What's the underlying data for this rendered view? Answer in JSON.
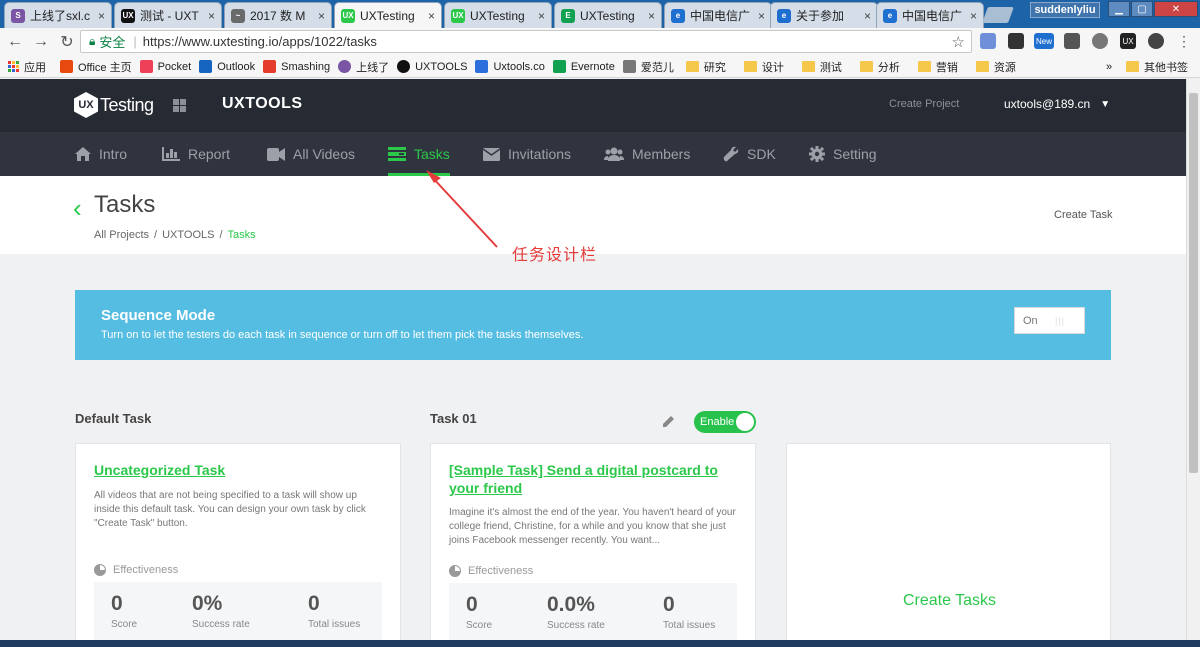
{
  "browser": {
    "tabs": [
      {
        "label": "上线了sxl.c",
        "icon_color": "#7a55a3",
        "icon_text": "S",
        "close": "×"
      },
      {
        "label": "测试 - UXT",
        "icon_color": "#111111",
        "icon_text": "UX",
        "close": "×"
      },
      {
        "label": "2017 数 M",
        "icon_color": "#6a6a6a",
        "icon_text": "~",
        "close": "×"
      },
      {
        "label": "UXTesting",
        "icon_color": "#2bc84a",
        "icon_text": "UX",
        "close": "×",
        "active": true
      },
      {
        "label": "UXTesting",
        "icon_color": "#2bc84a",
        "icon_text": "UX",
        "close": "×"
      },
      {
        "label": "UXTesting",
        "icon_color": "#12a150",
        "icon_text": "E",
        "close": "×"
      },
      {
        "label": "中国电信广",
        "icon_color": "#1f6fd1",
        "icon_text": "e",
        "close": "×"
      },
      {
        "label": "关于参加",
        "icon_color": "#1f6fd1",
        "icon_text": "e",
        "close": "×"
      },
      {
        "label": "中国电信广",
        "icon_color": "#1f6fd1",
        "icon_text": "e",
        "close": "×"
      }
    ],
    "profile": "suddenlyliu",
    "url_secure_label": "安全",
    "url_separator": "|",
    "url": "https://www.uxtesting.io/apps/1022/tasks",
    "bookmarks": [
      {
        "label": "应用",
        "type": "apps"
      },
      {
        "label": "Office 主页",
        "type": "icon",
        "color": "#e8490f"
      },
      {
        "label": "Pocket",
        "type": "icon",
        "color": "#ee4056"
      },
      {
        "label": "Outlook",
        "type": "icon",
        "color": "#1565c0"
      },
      {
        "label": "Smashing",
        "type": "icon",
        "color": "#e53b2c"
      },
      {
        "label": "上线了",
        "type": "icon",
        "color": "#7a55a3"
      },
      {
        "label": "UXTOOLS",
        "type": "icon",
        "color": "#111111"
      },
      {
        "label": "Uxtools.co",
        "type": "icon",
        "color": "#2a6fdb"
      },
      {
        "label": "Evernote",
        "type": "icon",
        "color": "#12a150"
      },
      {
        "label": "爱范儿",
        "type": "icon",
        "color": "#777777"
      },
      {
        "label": "研究",
        "type": "folder"
      },
      {
        "label": "设计",
        "type": "folder"
      },
      {
        "label": "测试",
        "type": "folder"
      },
      {
        "label": "分析",
        "type": "folder"
      },
      {
        "label": "营销",
        "type": "folder"
      },
      {
        "label": "资源",
        "type": "folder"
      }
    ],
    "bookmarks_overflow": "»",
    "other_bookmarks": "其他书签"
  },
  "app": {
    "logo_badge": "UX",
    "logo_text": "Testing",
    "project_name": "UXTOOLS",
    "create_project": "Create Project",
    "user_email": "uxtools@189.cn",
    "nav": [
      {
        "label": "Intro",
        "icon": "home-icon"
      },
      {
        "label": "Report",
        "icon": "bar-chart-icon"
      },
      {
        "label": "All Videos",
        "icon": "video-camera-icon"
      },
      {
        "label": "Tasks",
        "icon": "tasks-icon",
        "active": true
      },
      {
        "label": "Invitations",
        "icon": "envelope-icon"
      },
      {
        "label": "Members",
        "icon": "users-icon"
      },
      {
        "label": "SDK",
        "icon": "wrench-icon"
      },
      {
        "label": "Setting",
        "icon": "gear-icon"
      }
    ],
    "page_title": "Tasks",
    "breadcrumb": {
      "items": [
        "All Projects",
        "UXTOOLS"
      ],
      "current": "Tasks",
      "sep": "/"
    },
    "create_task": "Create Task",
    "annotation": "任务设计栏",
    "sequence": {
      "title": "Sequence Mode",
      "subtitle": "Turn on to let the testers do each task in sequence or turn off to let them pick the tasks themselves.",
      "toggle_label": "On"
    },
    "default_task_heading": "Default Task",
    "task01_heading": "Task 01",
    "enable_label": "Enable",
    "cards": [
      {
        "title": "Uncategorized Task",
        "description": "All videos that are not being specified to a task will show up inside this default task. You can design your own task by click \"Create Task\" button.",
        "effectiveness_label": "Effectiveness",
        "stats": [
          {
            "value": "0",
            "label": "Score"
          },
          {
            "value": "0%",
            "label": "Success rate"
          },
          {
            "value": "0",
            "label": "Total issues"
          }
        ]
      },
      {
        "title": "[Sample Task] Send a digital postcard to your friend",
        "description": "Imagine it's almost the end of the year. You haven't heard of your college friend, Christine, for a while and you know that she just joins Facebook messenger recently. You want...",
        "effectiveness_label": "Effectiveness",
        "stats": [
          {
            "value": "0",
            "label": "Score"
          },
          {
            "value": "0.0%",
            "label": "Success rate"
          },
          {
            "value": "0",
            "label": "Total issues"
          }
        ]
      }
    ],
    "create_tasks_label": "Create Tasks"
  }
}
